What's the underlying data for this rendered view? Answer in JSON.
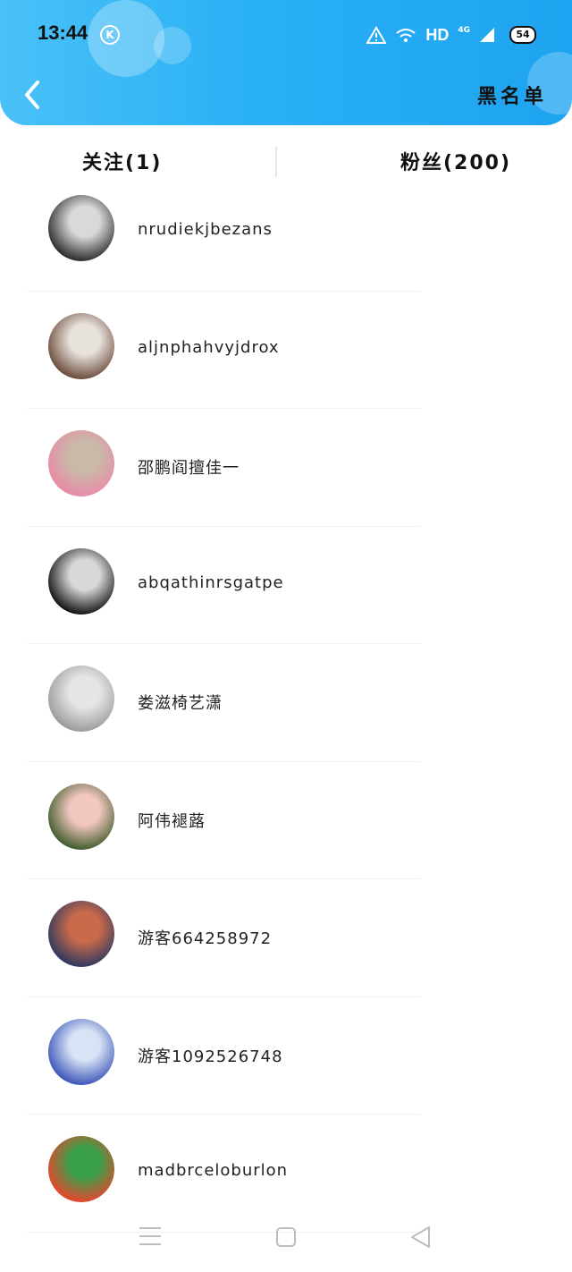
{
  "status_bar": {
    "time": "13:44",
    "app_badge": "K",
    "network_type": "HD",
    "network_gen": "4G",
    "battery": "54"
  },
  "header": {
    "back_icon": "chevron-left-icon",
    "blacklist_label": "黑名单"
  },
  "tabs": {
    "following": "关注(1)",
    "fans": "粉丝(200)"
  },
  "users": [
    {
      "name": "nrudiekjbezans",
      "avatar_colors": [
        "#2a2a2a",
        "#d9d9d9"
      ]
    },
    {
      "name": "aljnphahvyjdrox",
      "avatar_colors": [
        "#6b4a3a",
        "#e8e2dc"
      ]
    },
    {
      "name": "邵鹏阎擅佳一",
      "avatar_colors": [
        "#e98aa8",
        "#c9b9a8"
      ]
    },
    {
      "name": "abqathinrsgatpe",
      "avatar_colors": [
        "#111111",
        "#d8d8d8"
      ]
    },
    {
      "name": "娄滋椅艺潇",
      "avatar_colors": [
        "#9a9a9a",
        "#e6e6e6"
      ]
    },
    {
      "name": "阿伟褪蕗",
      "avatar_colors": [
        "#3f5a2a",
        "#f2c7c0"
      ]
    },
    {
      "name": "游客664258972",
      "avatar_colors": [
        "#2c3860",
        "#c96a4a"
      ]
    },
    {
      "name": "游客1092526748",
      "avatar_colors": [
        "#3a54b8",
        "#d8e3f5"
      ]
    },
    {
      "name": "madbrceloburlon",
      "avatar_colors": [
        "#e8452c",
        "#3aa04a"
      ]
    }
  ],
  "navbar": {
    "menu_icon": "menu-icon",
    "home_icon": "home-icon",
    "back_icon": "back-triangle-icon"
  }
}
